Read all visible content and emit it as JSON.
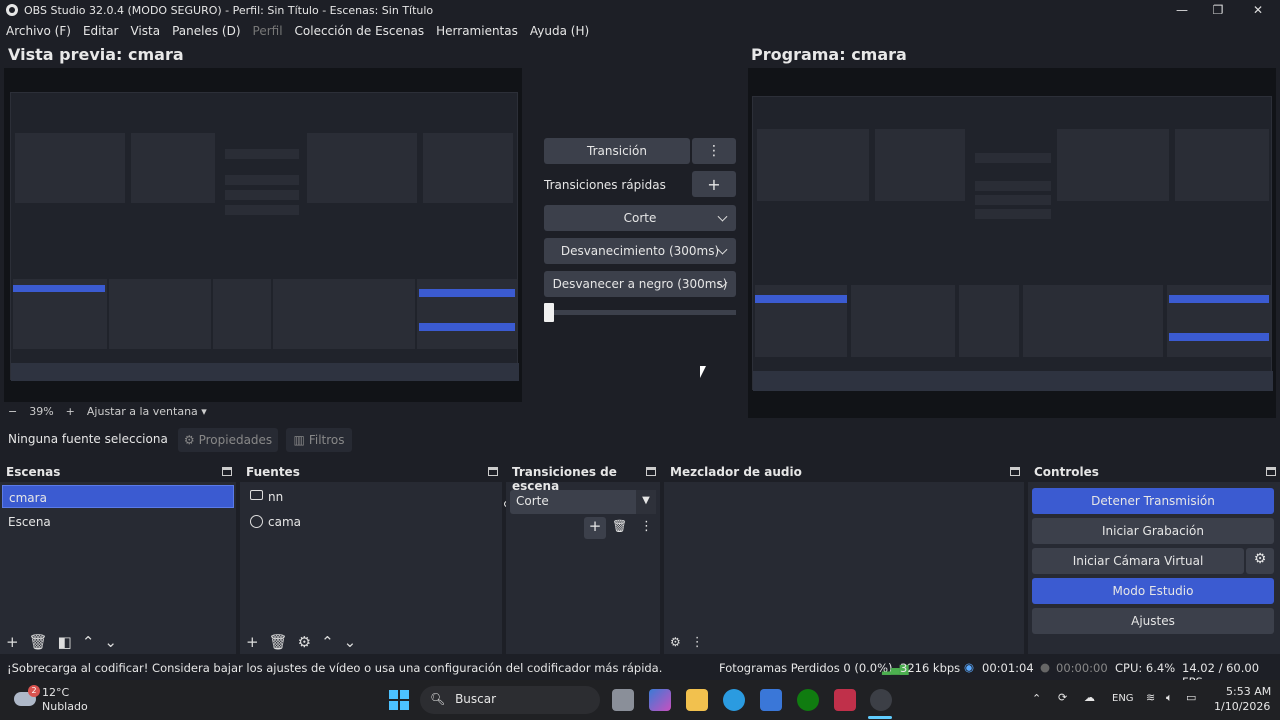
{
  "window": {
    "title": "OBS Studio 32.0.4 (MODO SEGURO) - Perfil: Sin Título - Escenas: Sin Título"
  },
  "menu": [
    "Archivo (F)",
    "Editar",
    "Vista",
    "Paneles (D)",
    "Perfil",
    "Colección de Escenas",
    "Herramientas",
    "Ayuda (H)"
  ],
  "preview": {
    "title": "Vista previa: cmara",
    "zoom_minus": "−",
    "zoom": "39%",
    "zoom_plus": "+",
    "fit_label": "Ajustar a la ventana"
  },
  "program": {
    "title": "Programa: cmara"
  },
  "transitions": {
    "transition_button": "Transición",
    "quick_label": "Transiciones rápidas",
    "options": [
      "Corte",
      "Desvanecimiento (300ms)",
      "Desvanecer a negro (300ms)"
    ]
  },
  "source_toolbar": {
    "no_source": "Ninguna fuente selecciona",
    "properties": "Propiedades",
    "filters": "Filtros"
  },
  "docks": {
    "scenes": {
      "title": "Escenas",
      "items": [
        "cmara",
        "Escena"
      ]
    },
    "sources": {
      "title": "Fuentes",
      "items": [
        "nn",
        "cama"
      ]
    },
    "scene_transitions": {
      "title": "Transiciones de escena",
      "selected": "Corte"
    },
    "audio_mixer": {
      "title": "Mezclador de audio"
    },
    "controls": {
      "title": "Controles",
      "stop_stream": "Detener Transmisión",
      "start_record": "Iniciar Grabación",
      "start_virtual_cam": "Iniciar Cámara Virtual",
      "studio_mode": "Modo Estudio",
      "settings": "Ajustes"
    }
  },
  "status": {
    "warning": "¡Sobrecarga al codificar! Considera bajar los ajustes de vídeo o usa una configuración del codificador más rápida.",
    "dropped_frames": "Fotogramas Perdidos 0 (0.0%)",
    "bitrate": "3216 kbps",
    "stream_time": "00:01:04",
    "record_time": "00:00:00",
    "cpu": "CPU: 6.4%",
    "fps": "14.02 / 60.00 FPS"
  },
  "taskbar": {
    "weather_temp": "12°C",
    "weather_desc": "Nublado",
    "weather_badge": "2",
    "search_placeholder": "Buscar",
    "language": "ENG",
    "time": "5:53 AM",
    "date": "1/10/2026"
  },
  "colors": {
    "accent": "#3b5bd1",
    "panel": "#272a33",
    "background": "#1d1f26"
  }
}
